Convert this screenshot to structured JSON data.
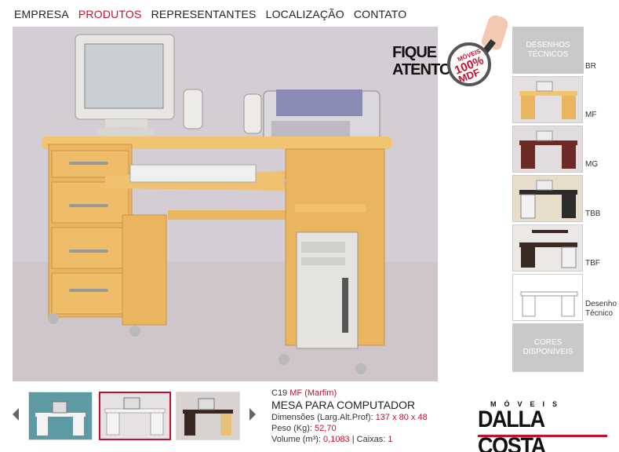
{
  "nav": {
    "items": [
      {
        "label": "EMPRESA",
        "active": false
      },
      {
        "label": "PRODUTOS",
        "active": true
      },
      {
        "label": "REPRESENTANTES",
        "active": false
      },
      {
        "label": "LOCALIZAÇÃO",
        "active": false
      },
      {
        "label": "CONTATO",
        "active": false
      }
    ]
  },
  "promo": {
    "line1": "FIQUE",
    "line2": "ATENTO",
    "lens_top": "MÓVEIS",
    "lens_mid": "100%",
    "lens_bottom": "MDF"
  },
  "sidebar": {
    "drawings_button": "DESENHOS TÉCNICOS",
    "colors_button": "CORES DISPONÍVEIS",
    "finishes": [
      {
        "label": "BR"
      },
      {
        "label": "MF"
      },
      {
        "label": "MG"
      },
      {
        "label": "TBB"
      },
      {
        "label": "TBF"
      },
      {
        "label": "Desenho Técnico"
      }
    ]
  },
  "product": {
    "code": "C19",
    "finish": "MF (Marfim)",
    "name": "MESA PARA COMPUTADOR",
    "dimensions_label": "Dimensões (Larg.Alt.Prof):",
    "dimensions_value": "137 x 80 x 48",
    "weight_label": "Peso (Kg):",
    "weight_value": "52,70",
    "volume_label": "Volume (m³):",
    "volume_value": "0,1083",
    "boxes_label": "| Caixas:",
    "boxes_value": "1"
  },
  "logo": {
    "moveis": "MÓVEIS",
    "brand": "DALLA COSTA"
  },
  "colors": {
    "accent": "#c8102e",
    "wood": "#e8b45a",
    "sidebar_button": "#c9c9c9"
  }
}
